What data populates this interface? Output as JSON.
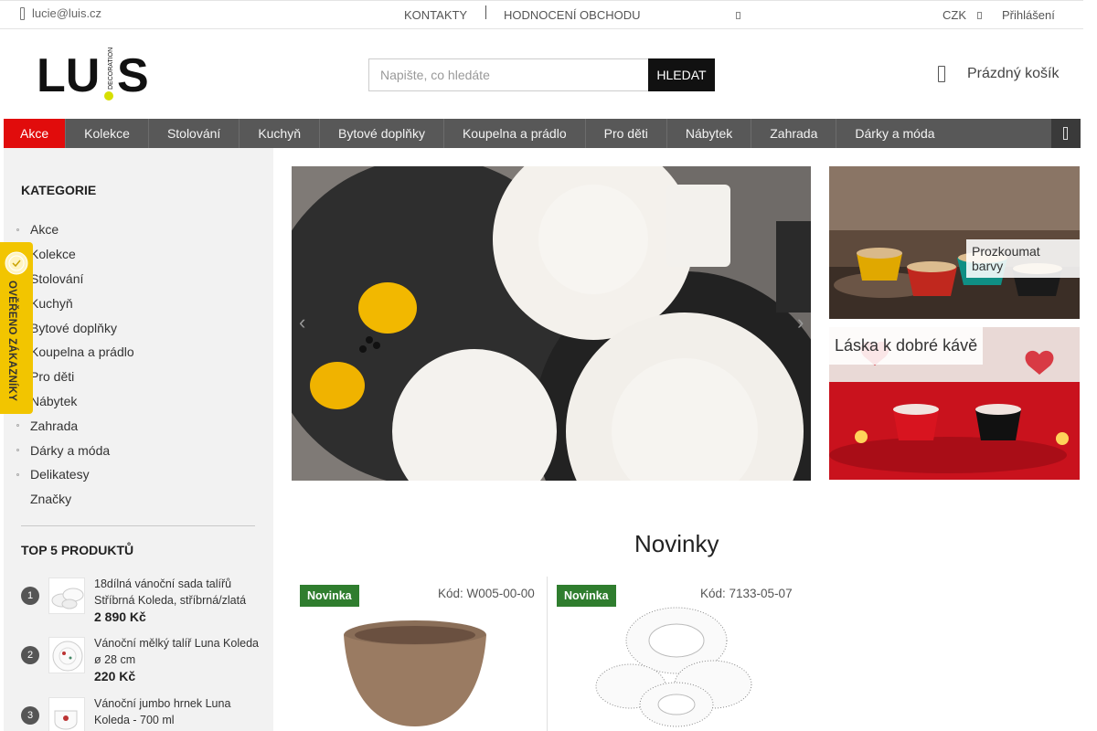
{
  "topbar": {
    "email": "lucie@luis.cz",
    "links": [
      "KONTAKTY",
      "HODNOCENÍ OBCHODU"
    ],
    "currency": "CZK",
    "login": "Přihlášení"
  },
  "logo": {
    "main": "LU",
    "tagline": "DECORATION",
    "letter": "S"
  },
  "search": {
    "placeholder": "Napište, co hledáte",
    "button": "HLEDAT"
  },
  "cart": {
    "label": "Prázdný košík"
  },
  "nav": {
    "items": [
      "Akce",
      "Kolekce",
      "Stolování",
      "Kuchyň",
      "Bytové doplňky",
      "Koupelna a prádlo",
      "Pro děti",
      "Nábytek",
      "Zahrada",
      "Dárky a móda"
    ],
    "active_index": 0
  },
  "sidebar": {
    "categories_title": "KATEGORIE",
    "categories": [
      "Akce",
      "Kolekce",
      "Stolování",
      "Kuchyň",
      "Bytové doplňky",
      "Koupelna a prádlo",
      "Pro děti",
      "Nábytek",
      "Zahrada",
      "Dárky a móda",
      "Delikatesy",
      "Značky"
    ],
    "top_title": "TOP 5 PRODUKTŮ",
    "top_products": [
      {
        "rank": "1",
        "name": "18dílná vánoční sada talířů Stříbrná Koleda, stříbrná/zlatá",
        "price": "2 890 Kč"
      },
      {
        "rank": "2",
        "name": "Vánoční mělký talíř Luna Koleda ø 28 cm",
        "price": "220 Kč"
      },
      {
        "rank": "3",
        "name": "Vánoční jumbo hrnek Luna Koleda - 700 ml",
        "price": ""
      }
    ]
  },
  "badge": {
    "text": "OVĚŘENO ZÁKAZNÍKY"
  },
  "banners": {
    "top_label": "Prozkoumat barvy",
    "bottom_label": "Láska k dobré kávě"
  },
  "novinky": {
    "title": "Novinky",
    "products": [
      {
        "tag": "Novinka",
        "code": "Kód: W005-00-00"
      },
      {
        "tag": "Novinka",
        "code": "Kód: 7133-05-07"
      }
    ]
  },
  "colors": {
    "nav_bg": "#585858",
    "accent_red": "#e10c0c",
    "badge_green": "#2f7d2e",
    "badge_yellow": "#f2c500"
  }
}
